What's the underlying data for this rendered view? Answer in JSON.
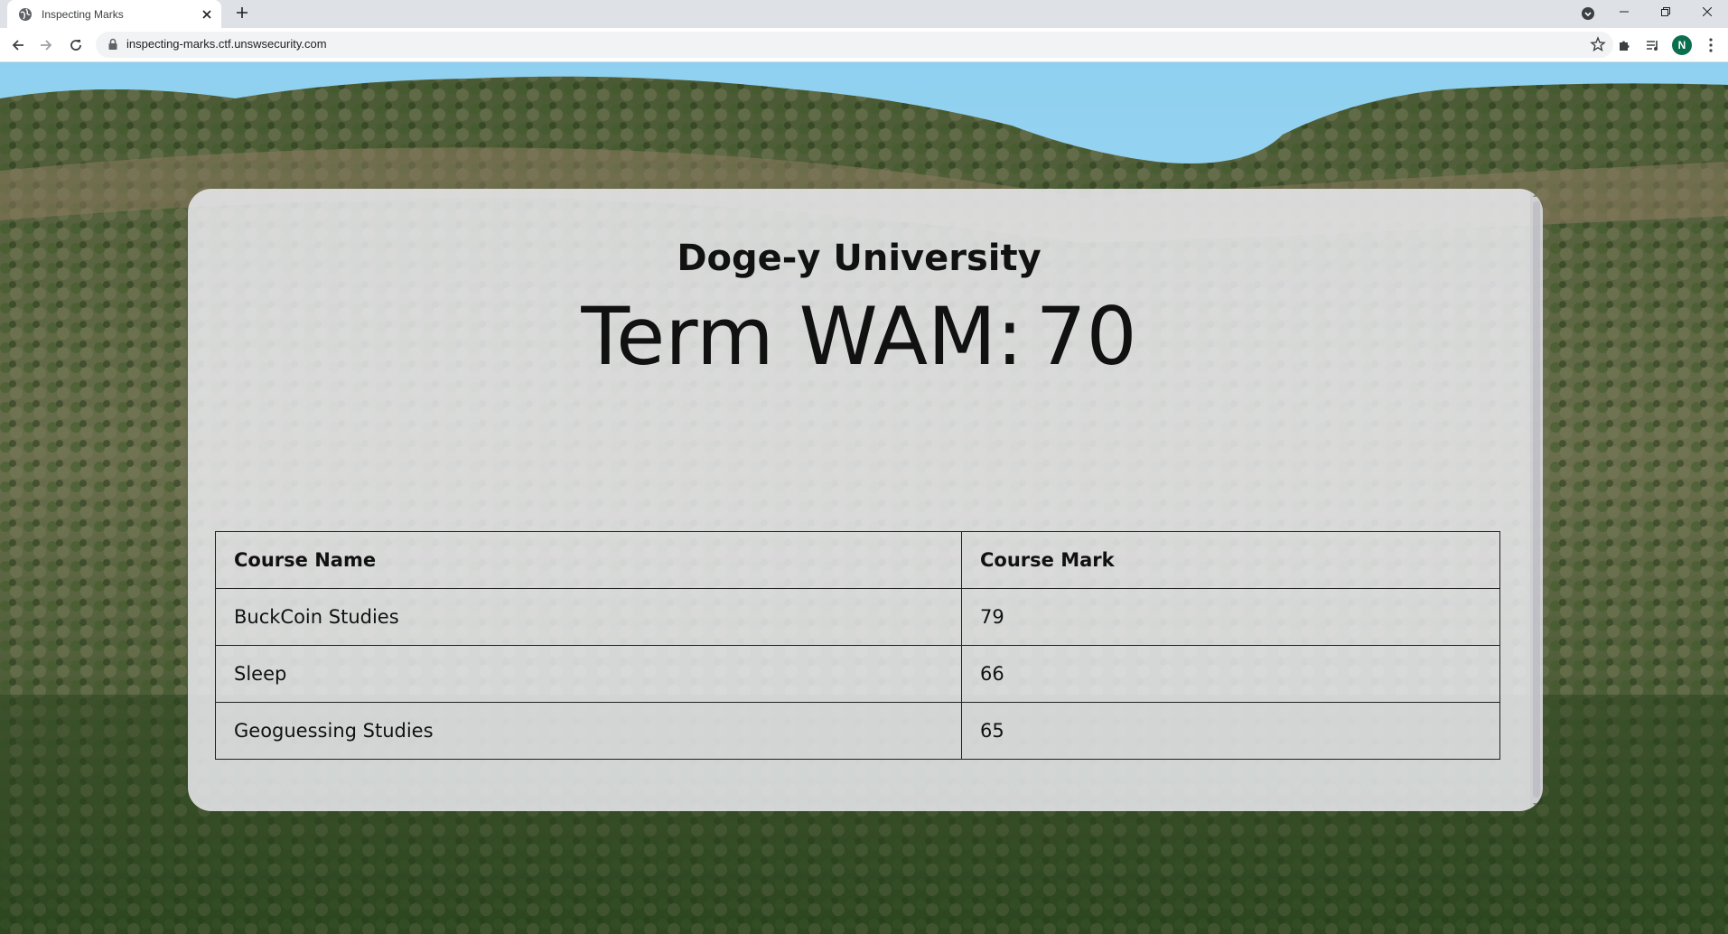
{
  "browser": {
    "tab_title": "Inspecting Marks",
    "url": "inspecting-marks.ctf.unswsecurity.com",
    "profile_initial": "N"
  },
  "page": {
    "university": "Doge-y University",
    "wam_label": "Term WAM:",
    "wam_value": "70",
    "table": {
      "headers": [
        "Course Name",
        "Course Mark"
      ],
      "rows": [
        [
          "BuckCoin Studies",
          "79"
        ],
        [
          "Sleep",
          "66"
        ],
        [
          "Geoguessing Studies",
          "65"
        ]
      ]
    }
  },
  "colors": {
    "sky": "#7cc8ee",
    "forest_dark": "#2f4a22",
    "card_bg": "#ebebf0",
    "avatar": "#0b6e4f"
  }
}
